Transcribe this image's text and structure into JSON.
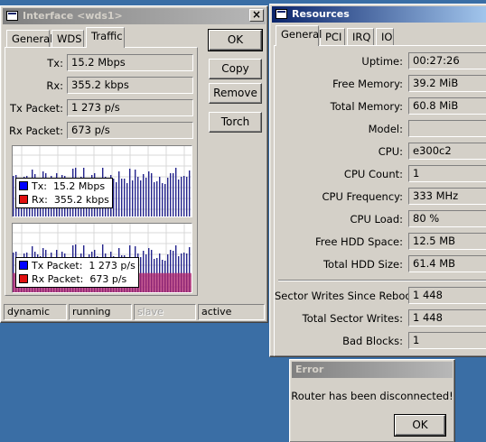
{
  "interface_window": {
    "title": "Interface <wds1>",
    "close_glyph": "×",
    "tabs": [
      "General",
      "WDS",
      "Traffic"
    ],
    "selected_tab": "Traffic",
    "fields": [
      {
        "label": "Tx:",
        "value": "15.2 Mbps"
      },
      {
        "label": "Rx:",
        "value": "355.2 kbps"
      },
      {
        "label": "Tx Packet:",
        "value": "1 273 p/s"
      },
      {
        "label": "Rx Packet:",
        "value": "673 p/s"
      }
    ],
    "buttons": {
      "ok": "OK",
      "copy": "Copy",
      "remove": "Remove",
      "torch": "Torch"
    },
    "graph_rate": {
      "tx_label": "Tx:",
      "tx_value": "15.2 Mbps",
      "rx_label": "Rx:",
      "rx_value": "355.2 kbps"
    },
    "graph_packet": {
      "tx_label": "Tx Packet:",
      "tx_value": "1 273 p/s",
      "rx_label": "Rx Packet:",
      "rx_value": "673 p/s"
    },
    "status_bar": [
      "dynamic",
      "running",
      "slave",
      "active"
    ],
    "colors": {
      "tx": "#0000ff",
      "rx": "#e01010",
      "bars": "#24248c",
      "packet_rx": "#b0246c"
    }
  },
  "resources_window": {
    "title": "Resources",
    "tabs": [
      "General",
      "PCI",
      "IRQ",
      "IO"
    ],
    "selected_tab": "General",
    "fields": [
      {
        "label": "Uptime:",
        "value": "00:27:26"
      },
      {
        "label": "Free Memory:",
        "value": "39.2 MiB"
      },
      {
        "label": "Total Memory:",
        "value": "60.8 MiB"
      },
      {
        "label": "Model:",
        "value": ""
      },
      {
        "label": "CPU:",
        "value": "e300c2"
      },
      {
        "label": "CPU Count:",
        "value": "1"
      },
      {
        "label": "CPU Frequency:",
        "value": "333 MHz"
      },
      {
        "label": "CPU Load:",
        "value": "80 %"
      },
      {
        "label": "Free HDD Space:",
        "value": "12.5 MB"
      },
      {
        "label": "Total HDD Size:",
        "value": "61.4 MB"
      }
    ],
    "sector_fields": [
      {
        "label": "Sector Writes Since Reboot:",
        "value": "1 448"
      },
      {
        "label": "Total Sector Writes:",
        "value": "1 448"
      },
      {
        "label": "Bad Blocks:",
        "value": "1"
      }
    ]
  },
  "error_dialog": {
    "title": "Error",
    "message": "Router has been disconnected!",
    "ok_label": "OK"
  }
}
